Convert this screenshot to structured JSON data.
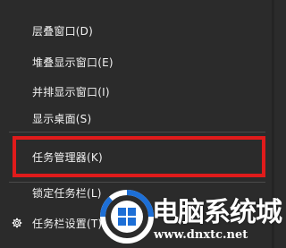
{
  "menu": {
    "items": [
      {
        "label": "层叠窗口(D)"
      },
      {
        "label": "堆叠显示窗口(E)"
      },
      {
        "label": "并排显示窗口(I)"
      },
      {
        "label": "显示桌面(S)"
      },
      {
        "label": "任务管理器(K)"
      },
      {
        "label": "锁定任务栏(L)"
      },
      {
        "label": "任务栏设置(T)"
      }
    ]
  },
  "watermark": {
    "title": "电脑系统城",
    "url": "www.dnxtc.net"
  },
  "colors": {
    "menu_bg": "#2b2b2b",
    "text": "#f2f2f2",
    "highlight_border": "#e01b1b",
    "separator": "#4a4a4a",
    "logo_blue": "#1d6fd6"
  }
}
